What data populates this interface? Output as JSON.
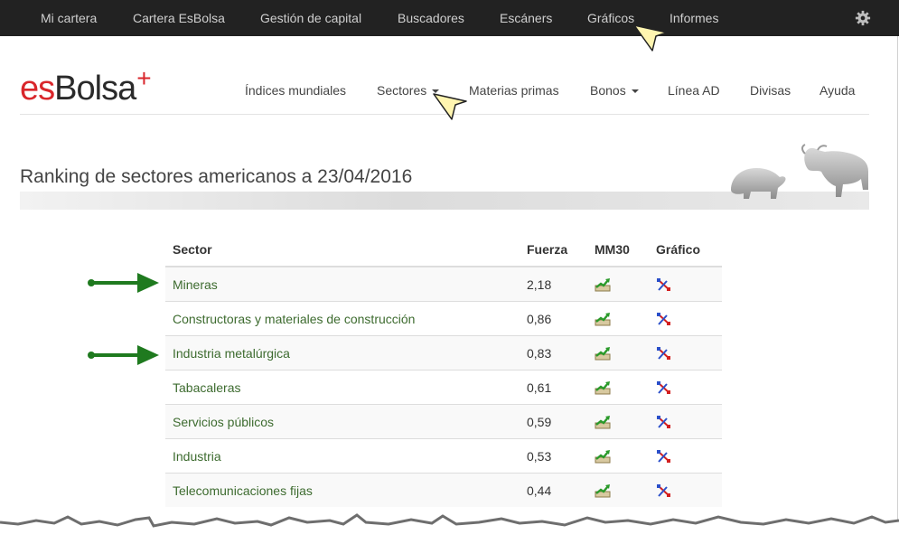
{
  "top_nav": {
    "items": [
      "Mi cartera",
      "Cartera EsBolsa",
      "Gestión de capital",
      "Buscadores",
      "Escáners",
      "Gráficos",
      "Informes"
    ],
    "settings_icon": "gear-icon"
  },
  "logo": {
    "es": "es",
    "bolsa": "Bolsa",
    "plus": "+"
  },
  "main_nav": {
    "items": [
      "Índices mundiales",
      "Sectores",
      "Materias primas",
      "Bonos",
      "Línea AD",
      "Divisas",
      "Ayuda"
    ]
  },
  "page_title": "Ranking de sectores americanos a 23/04/2016",
  "table": {
    "headers": {
      "sector": "Sector",
      "fuerza": "Fuerza",
      "mm30": "MM30",
      "grafico": "Gráfico"
    },
    "rows": [
      {
        "sector": "Mineras",
        "fuerza": "2,18"
      },
      {
        "sector": "Constructoras y materiales de construcción",
        "fuerza": "0,86"
      },
      {
        "sector": "Industria metalúrgica",
        "fuerza": "0,83"
      },
      {
        "sector": "Tabacaleras",
        "fuerza": "0,61"
      },
      {
        "sector": "Servicios públicos",
        "fuerza": "0,59"
      },
      {
        "sector": "Industria",
        "fuerza": "0,53"
      },
      {
        "sector": "Telecomunicaciones fijas",
        "fuerza": "0,44"
      }
    ]
  },
  "colors": {
    "topbar": "#222222",
    "brand_red": "#d9262b",
    "link_green": "#3d6b2f",
    "annotation_arrow": "#1f7a1f"
  }
}
